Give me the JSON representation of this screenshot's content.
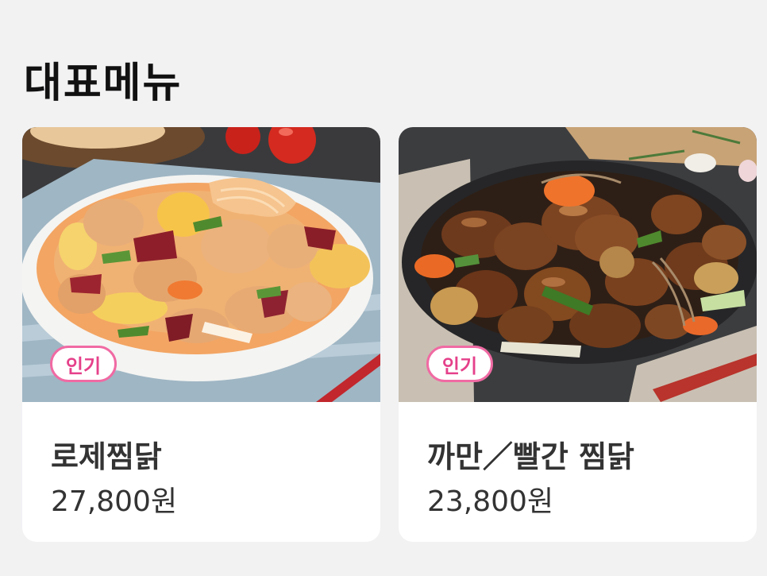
{
  "section": {
    "title": "대표메뉴"
  },
  "menu": [
    {
      "name": "로제찜닭",
      "price": "27,800원",
      "badge": "인기",
      "image_icon": "rose-braised-chicken-photo"
    },
    {
      "name": "까만／빨간 찜닭",
      "price": "23,800원",
      "badge": "인기",
      "image_icon": "soy-braised-chicken-photo"
    }
  ],
  "colors": {
    "background": "#f2f2f3",
    "card": "#ffffff",
    "badge_border": "#f06aa3",
    "badge_text": "#e5408a"
  }
}
